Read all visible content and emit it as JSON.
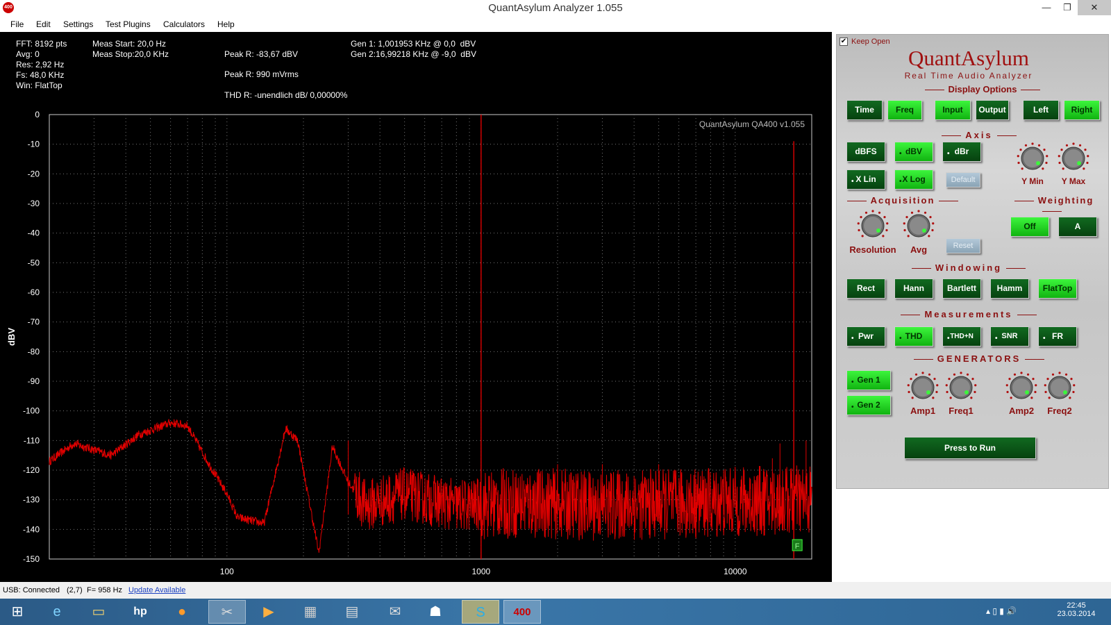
{
  "window": {
    "title": "QuantAsylum Analyzer 1.055",
    "app_icon": "400",
    "minimize": "—",
    "maximize": "❐",
    "close": "✕"
  },
  "menu": [
    "File",
    "Edit",
    "Settings",
    "Test Plugins",
    "Calculators",
    "Help"
  ],
  "info": {
    "col1": [
      "FFT: 8192 pts",
      "Avg: 0",
      "Res: 2,92 Hz",
      "Fs: 48,0 KHz",
      "Win: FlatTop"
    ],
    "meas_start": "Meas Start: 20,0 Hz",
    "meas_stop": "Meas Stop:20,0 KHz",
    "peak_r_dbv": "Peak R: -83,67 dBV",
    "peak_r_mv": "Peak R: 990 mVrms",
    "thd_r": "THD R: -unendlich dB/ 0,00000%",
    "gen1": "Gen 1: 1,001953 KHz @ 0,0  dBV",
    "gen2": "Gen 2:16,99218 KHz @ -9,0  dBV"
  },
  "chart_data": {
    "type": "line",
    "title": "QuantAsylum QA400 v1.055",
    "xlabel": "",
    "ylabel": "dBV",
    "x_scale": "log",
    "xlim": [
      20,
      20000
    ],
    "ylim": [
      -150,
      0
    ],
    "x_ticks": [
      100,
      1000,
      10000
    ],
    "y_ticks": [
      0,
      -10,
      -20,
      -30,
      -40,
      -50,
      -60,
      -70,
      -80,
      -90,
      -100,
      -110,
      -120,
      -130,
      -140,
      -150
    ],
    "grid": true,
    "line_color": "#e00000",
    "fundamentals": [
      {
        "x": 1000,
        "y": 0
      },
      {
        "x": 17000,
        "y": -9
      }
    ],
    "noise_floor": {
      "min": -150,
      "max": -125
    },
    "trend": [
      {
        "x": 20,
        "y": -117
      },
      {
        "x": 25,
        "y": -111
      },
      {
        "x": 35,
        "y": -115
      },
      {
        "x": 45,
        "y": -108
      },
      {
        "x": 60,
        "y": -104
      },
      {
        "x": 70,
        "y": -105
      },
      {
        "x": 85,
        "y": -118
      },
      {
        "x": 100,
        "y": -128
      },
      {
        "x": 110,
        "y": -136
      },
      {
        "x": 140,
        "y": -138
      },
      {
        "x": 170,
        "y": -106
      },
      {
        "x": 190,
        "y": -110
      },
      {
        "x": 230,
        "y": -148
      },
      {
        "x": 260,
        "y": -112
      },
      {
        "x": 300,
        "y": -124
      },
      {
        "x": 350,
        "y": -132
      },
      {
        "x": 500,
        "y": -128
      },
      {
        "x": 800,
        "y": -132
      },
      {
        "x": 1500,
        "y": -131
      },
      {
        "x": 3000,
        "y": -132
      },
      {
        "x": 8000,
        "y": -131
      },
      {
        "x": 20000,
        "y": -130
      }
    ],
    "spurs": [
      {
        "x": 300,
        "y": -110
      },
      {
        "x": 2000,
        "y": -118
      },
      {
        "x": 3000,
        "y": -118
      },
      {
        "x": 4000,
        "y": -122
      },
      {
        "x": 5000,
        "y": -118
      },
      {
        "x": 7000,
        "y": -123
      },
      {
        "x": 9000,
        "y": -120
      },
      {
        "x": 14000,
        "y": -116
      },
      {
        "x": 15000,
        "y": -111
      },
      {
        "x": 19000,
        "y": -110
      }
    ],
    "marker": "F"
  },
  "panel": {
    "keep_open": "Keep Open",
    "brand": "QuantAsylum",
    "subtitle": "Real Time Audio Analyzer",
    "sections": {
      "display": "Display Options",
      "axis": "Axis",
      "acquisition": "Acquisition",
      "weighting": "Weighting",
      "windowing": "Windowing",
      "measurements": "Measurements",
      "generators": "GENERATORS"
    },
    "display_buttons": {
      "time": "Time",
      "freq": "Freq",
      "input": "Input",
      "output": "Output",
      "left": "Left",
      "right": "Right"
    },
    "axis_buttons": {
      "dbfs": "dBFS",
      "dbv": "dBV",
      "dbr": "dBr",
      "xlin": "X Lin",
      "xlog": "X Log",
      "default": "Default"
    },
    "knobs": {
      "ymin": "Y Min",
      "ymax": "Y Max",
      "resolution": "Resolution",
      "avg": "Avg",
      "amp1": "Amp1",
      "freq1": "Freq1",
      "amp2": "Amp2",
      "freq2": "Freq2"
    },
    "reset": "Reset",
    "weighting_buttons": {
      "off": "Off",
      "a": "A"
    },
    "window_buttons": {
      "rect": "Rect",
      "hann": "Hann",
      "bartlett": "Bartlett",
      "hamm": "Hamm",
      "flattop": "FlatTop"
    },
    "meas_buttons": {
      "pwr": "Pwr",
      "thd": "THD",
      "thdn": "THD+N",
      "snr": "SNR",
      "fr": "FR"
    },
    "gen_buttons": {
      "gen1": "Gen 1",
      "gen2": "Gen 2"
    },
    "run": "Press to Run",
    "colors": {
      "on": "#22d422",
      "off": "#0a5a18",
      "accent": "#8b1010"
    }
  },
  "status": {
    "usb": "USB: Connected",
    "coords": "(2,7)",
    "freq": "F= 958 Hz",
    "update": "Update Available"
  },
  "taskbar": {
    "clock_time": "22:45",
    "clock_date": "23.03.2014"
  }
}
